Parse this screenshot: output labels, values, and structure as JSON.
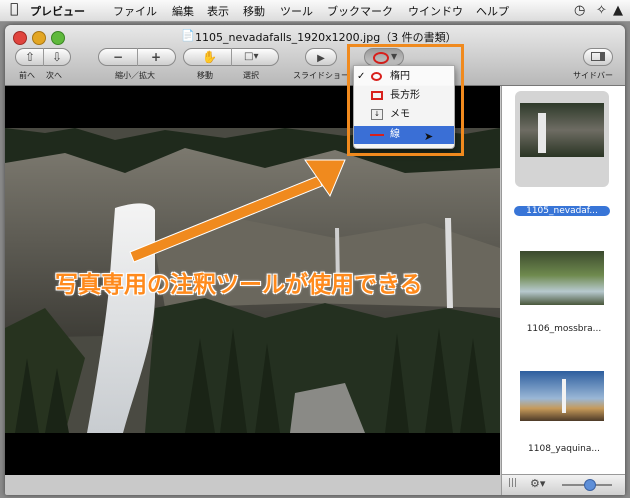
{
  "menubar": {
    "app_name": "プレビュー",
    "items": [
      "ファイル",
      "編集",
      "表示",
      "移動",
      "ツール",
      "ブックマーク",
      "ウインドウ",
      "ヘルプ"
    ]
  },
  "window": {
    "title": "1105_nevadafalls_1920x1200.jpg（3 件の書類）"
  },
  "toolbar": {
    "back_label": "前へ",
    "next_label": "次へ",
    "zoom_label": "縮小／拡大",
    "move_label": "移動",
    "select_label": "選択",
    "slideshow_label": "スライドショー",
    "sidebar_label": "サイドバー"
  },
  "annotate_menu": {
    "items": [
      {
        "label": "楕円",
        "checked": true,
        "icon": "ellipse-icon"
      },
      {
        "label": "長方形",
        "checked": false,
        "icon": "rectangle-icon"
      },
      {
        "label": "メモ",
        "checked": false,
        "icon": "note-icon"
      },
      {
        "label": "線",
        "checked": false,
        "icon": "line-icon",
        "highlighted": true
      }
    ],
    "check_mark": "✓"
  },
  "sidebar": {
    "items": [
      {
        "name": "1105_nevadaf...",
        "selected": true
      },
      {
        "name": "1106_mossbra...",
        "selected": false
      },
      {
        "name": "1108_yaquina...",
        "selected": false
      }
    ]
  },
  "caption": "写真専用の注釈ツールが使用できる",
  "colors": {
    "highlight": "#f08a1e",
    "selection": "#3875d7",
    "close": "#e0443e",
    "minimize": "#e3a623",
    "zoom": "#5fb93c"
  }
}
